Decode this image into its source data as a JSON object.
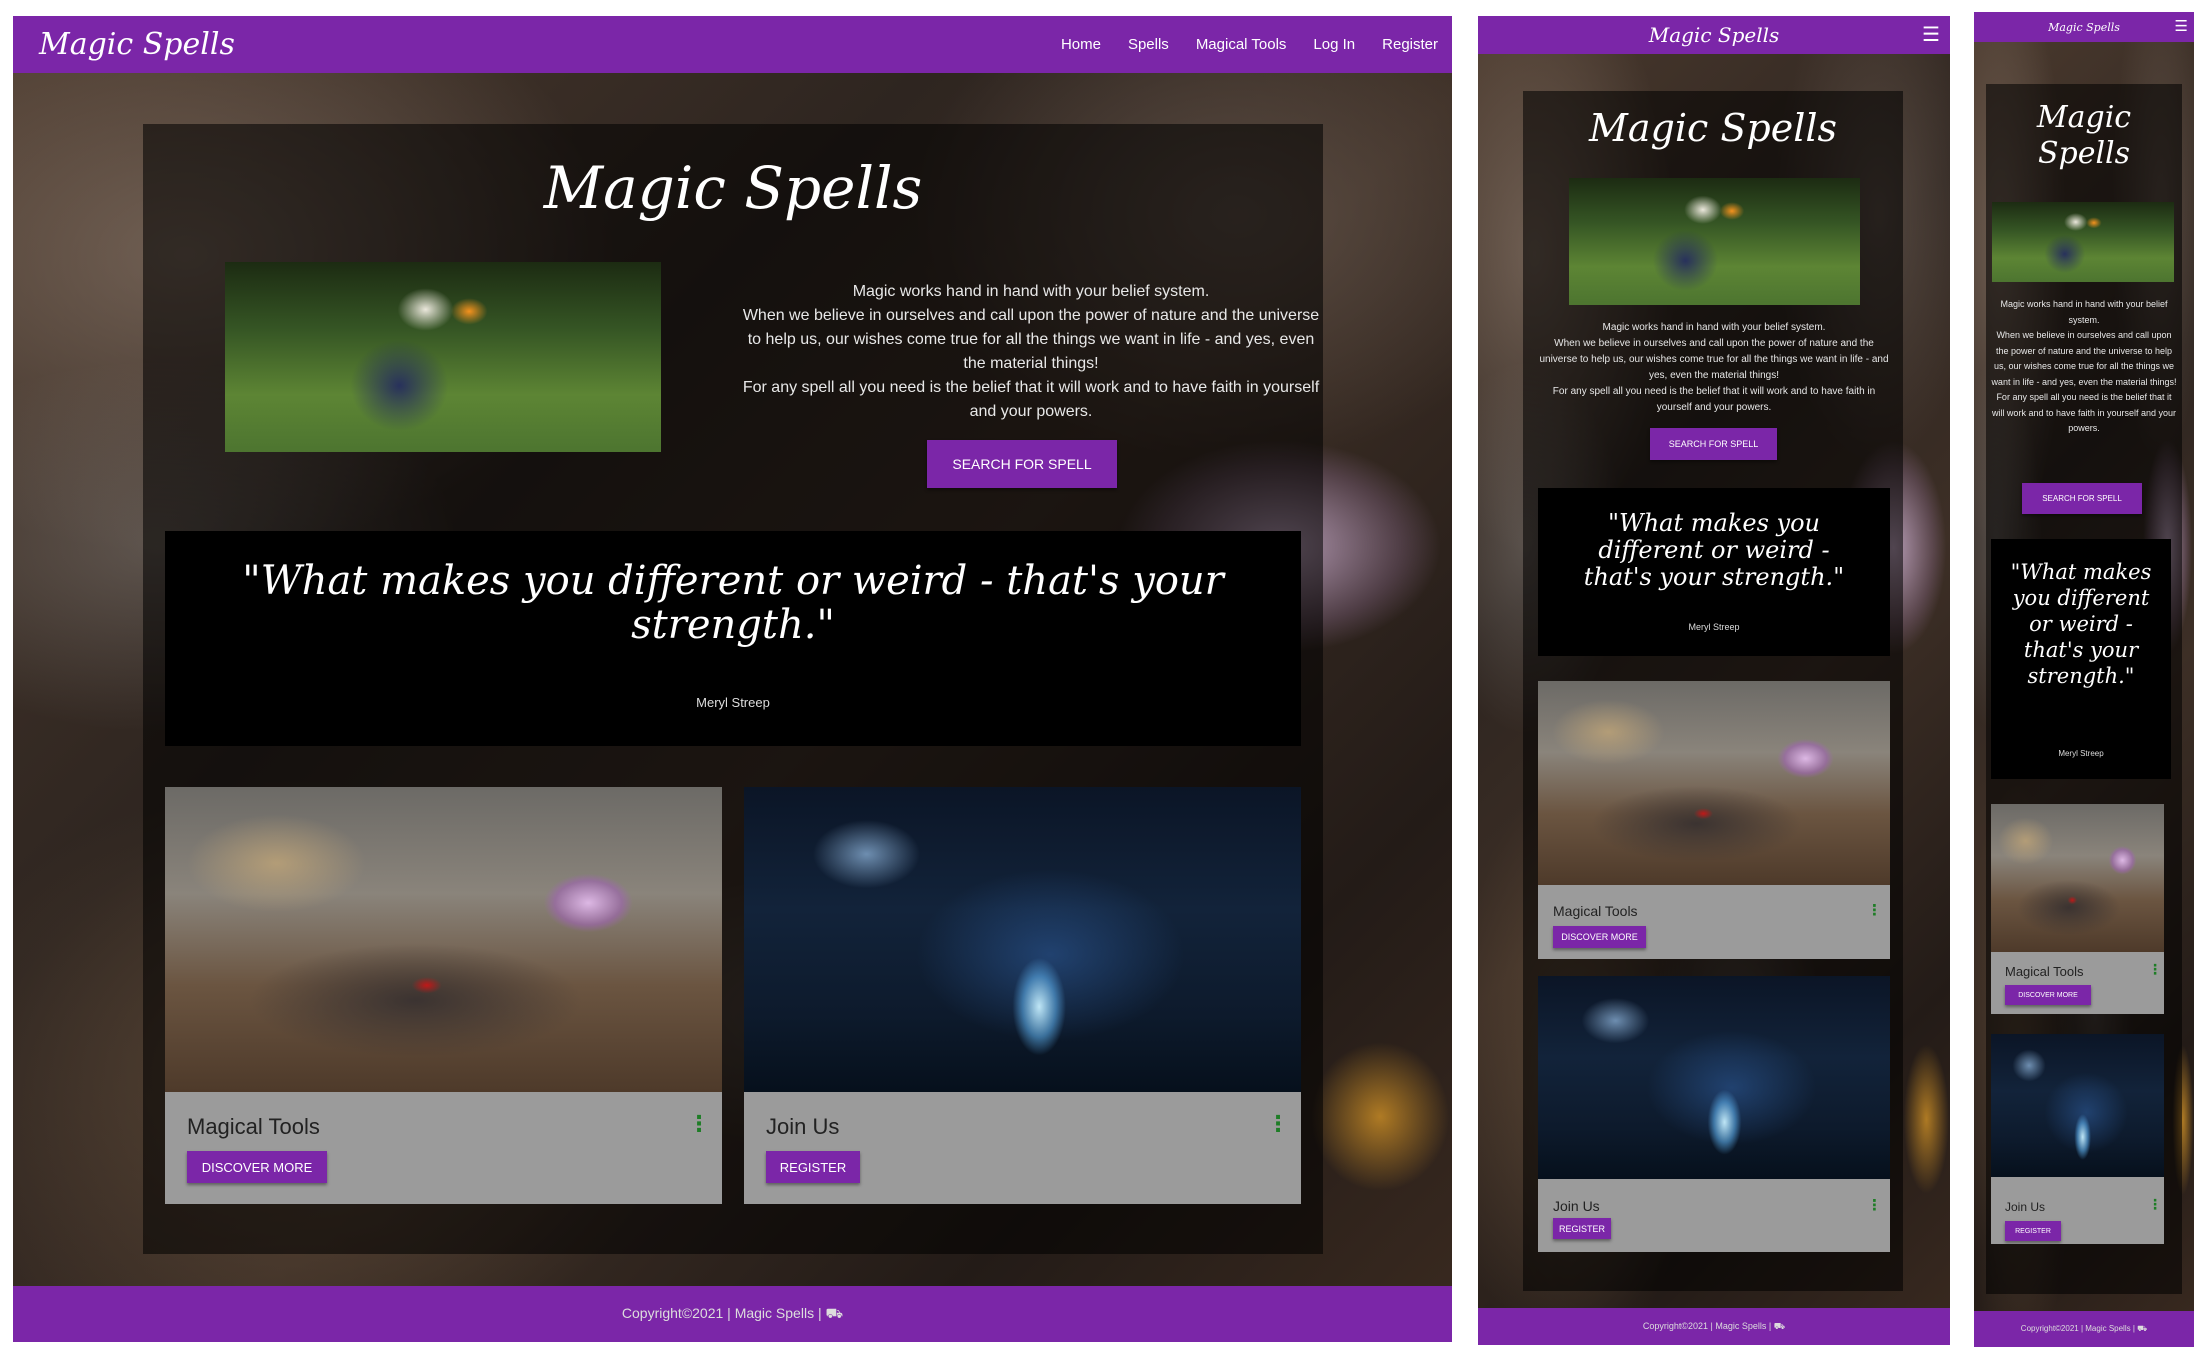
{
  "nav": {
    "brand": "Magic Spells",
    "links": [
      "Home",
      "Spells",
      "Magical Tools",
      "Log In",
      "Register"
    ],
    "menu_icon": "hamburger-menu-icon"
  },
  "hero": {
    "title": "Magic Spells",
    "intro": [
      "Magic works hand in hand with your belief system.",
      "When we believe in ourselves and call upon the power of nature and the universe to help us, our wishes come true for all the things we want in life - and yes, even the material things!",
      "For any spell all you need is the belief that it will work and to have faith in yourself and your powers."
    ],
    "search_button": "SEARCH FOR SPELL"
  },
  "quote": {
    "text": "\"What makes you different or weird - that's your strength.\"",
    "author": "Meryl Streep"
  },
  "cards": [
    {
      "title": "Magical Tools",
      "button": "DISCOVER MORE",
      "menu_icon": "more-vert-icon"
    },
    {
      "title": "Join Us",
      "button": "REGISTER",
      "menu_icon": "more-vert-icon"
    }
  ],
  "footer": {
    "text": "Copyright©2021 | Magic Spells | ⛟"
  },
  "colors": {
    "accent": "#7b26a8",
    "card": "#9b9b9b",
    "dots": "#1e7d26"
  }
}
